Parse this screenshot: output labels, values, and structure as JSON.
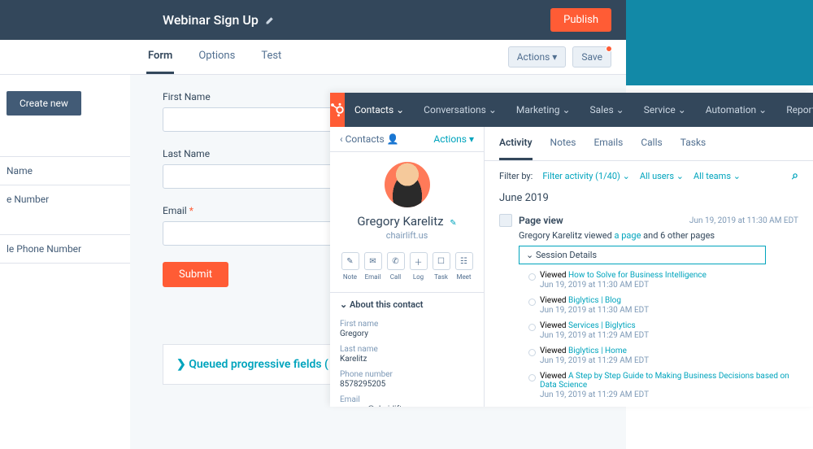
{
  "form_builder": {
    "title": "Webinar Sign Up",
    "publish": "Publish",
    "tabs": [
      "Form",
      "Options",
      "Test"
    ],
    "actions_btn": "Actions ▾",
    "save_btn": "Save",
    "create_new": "Create new",
    "field_palette": [
      "Name",
      "e Number",
      "le Phone Number"
    ],
    "fields": [
      {
        "label": "First Name",
        "required": false
      },
      {
        "label": "Last Name",
        "required": false
      },
      {
        "label": "Email",
        "required": true
      }
    ],
    "submit": "Submit",
    "queued": "❯  Queued progressive fields ("
  },
  "crm": {
    "nav": [
      "Contacts ⌄",
      "Conversations ⌄",
      "Marketing ⌄",
      "Sales ⌄",
      "Service ⌄",
      "Automation ⌄",
      "Reports ⌄"
    ],
    "back": "‹  Contacts",
    "actions": "Actions ▾",
    "contact": {
      "name": "Gregory Karelitz",
      "sub": "chairlift.us",
      "icons": [
        {
          "n": "Note",
          "g": "✎"
        },
        {
          "n": "Email",
          "g": "✉"
        },
        {
          "n": "Call",
          "g": "✆"
        },
        {
          "n": "Log",
          "g": "＋"
        },
        {
          "n": "Task",
          "g": "☐"
        },
        {
          "n": "Meet",
          "g": "☷"
        }
      ],
      "about_hdr": "⌄  About this contact",
      "about": [
        {
          "l": "First name",
          "v": "Gregory"
        },
        {
          "l": "Last name",
          "v": "Karelitz"
        },
        {
          "l": "Phone number",
          "v": "8578295205"
        },
        {
          "l": "Email",
          "v": "gregory@chairlift.us"
        }
      ]
    },
    "tabs": [
      "Activity",
      "Notes",
      "Emails",
      "Calls",
      "Tasks"
    ],
    "filter": {
      "label": "Filter by:",
      "items": [
        "Filter activity (1/40) ⌄",
        "All users ⌄",
        "All teams ⌄"
      ]
    },
    "month": "June 2019",
    "event": {
      "title": "Page view",
      "time": "Jun 19, 2019 at 11:30 AM EDT",
      "desc_pre": "Gregory Karelitz viewed ",
      "desc_link": "a page",
      "desc_post": " and 6 other pages",
      "session": "⌄  Session Details"
    },
    "history": [
      {
        "t": "How to Solve for Business Intelligence",
        "d": "Jun 19, 2019 at 11:30 AM EDT"
      },
      {
        "t": "Biglytics | Blog",
        "d": "Jun 19, 2019 at 11:30 AM EDT"
      },
      {
        "t": "Services | Biglytics",
        "d": "Jun 19, 2019 at 11:29 AM EDT"
      },
      {
        "t": "Biglytics | Home",
        "d": "Jun 19, 2019 at 11:29 AM EDT"
      },
      {
        "t": "A Step by Step Guide to Making Business Decisions based on Data Science",
        "d": "Jun 19, 2019 at 11:29 AM EDT"
      }
    ],
    "viewed_prefix": "Viewed "
  }
}
